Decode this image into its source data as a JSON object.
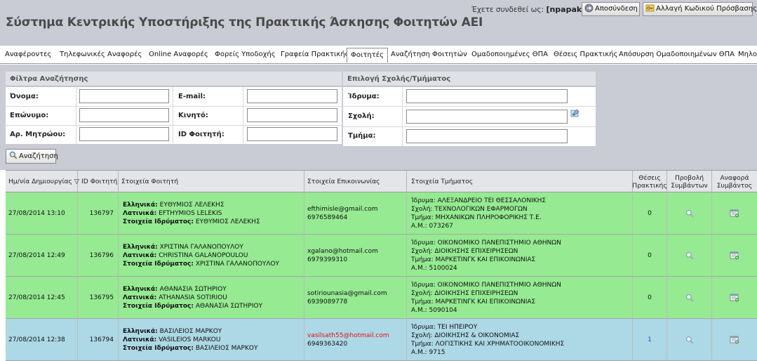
{
  "header": {
    "title": "Σύστημα Κεντρικής Υποστήριξης της Πρακτικής Άσκησης Φοιτητών ΑΕΙ",
    "login_prefix": "Έχετε συνδεθεί ως:",
    "username": "[npapako]",
    "logout_label": "Αποσύνδεση",
    "change_password_label": "Αλλαγή Κωδικού Πρόσβασης"
  },
  "nav": {
    "items": [
      "Αναφέροντες",
      "Τηλεφωνικές Αναφορές",
      "Online Αναφορές",
      "Φορείς Υποδοχής",
      "Γραφεία Πρακτικής",
      "Φοιτητές",
      "Αναζήτηση Φοιτητών",
      "Ομαδοποιημένες ΘΠΑ",
      "Θέσεις Πρακτικής",
      "Απόσυρση Ομαδοποιημένων ΘΠΑ",
      "Μηλο"
    ],
    "active": "Φοιτητές"
  },
  "filters": {
    "title": "Φίλτρα Αναζήτησης",
    "name_label": "Όνομα:",
    "surname_label": "Επώνυμο:",
    "reg_no_label": "Αρ. Μητρώου:",
    "email_label": "E-mail:",
    "mobile_label": "Κινητό:",
    "student_id_label": "ID Φοιτητή:",
    "name_value": "",
    "surname_value": "",
    "reg_no_value": "",
    "email_value": "",
    "mobile_value": "",
    "student_id_value": ""
  },
  "school_select": {
    "title": "Επιλογή Σχολής/Τμήματος",
    "institution_label": "Ίδρυμα:",
    "school_label": "Σχολή:",
    "department_label": "Τμήμα:",
    "institution_value": "",
    "school_value": "",
    "department_value": ""
  },
  "search_button": "Αναζήτηση",
  "table": {
    "headers": {
      "created": "Ημ/νία Δημιουργίας ▽",
      "student_id": "ID Φοιτητή",
      "student_info": "Στοιχεία Φοιτητή",
      "contact_info": "Στοιχεία Επικοινωνίας",
      "dept_info": "Στοιχεία Τμήματος",
      "positions": "Θέσεις Πρακτικής",
      "view_contracts": "Προβολή Συμβάντων",
      "report_contract": "Αναφορά Συμβάντος"
    },
    "labels": {
      "greek": "Ελληνικά:",
      "latin": "Λατινικά:",
      "institution_data": "Στοιχεία Ιδρύματος:"
    },
    "rows": [
      {
        "date": "27/08/2014 13:10",
        "id": "136797",
        "greek": "ΕΥΘΥΜΙΟΣ ΛΕΛΕΚΗΣ",
        "latin": "EFTHYMIOS LELEKIS",
        "inst": "ΕΥΘΥΜΙΟΣ ΛΕΛΕΚΗΣ",
        "email": "efthimisle@gmail.com",
        "phone": "6976589464",
        "institution": "Ίδρυμα: ΑΛΕΞΑΝΔΡΕΙΟ ΤΕΙ ΘΕΣΣΑΛΟΝΙΚΗΣ",
        "school": "Σχολή: ΤΕΧΝΟΛΟΓΙΚΩΝ ΕΦΑΡΜΟΓΩΝ",
        "department": "Τμήμα: ΜΗΧΑΝΙΚΩΝ ΠΛΗΡΟΦΟΡΙΚΗΣ Τ.Ε.",
        "am": "Α.Μ.: 073267",
        "positions": "0",
        "color": "#95ea92",
        "email_red": false
      },
      {
        "date": "27/08/2014 12:49",
        "id": "136796",
        "greek": "ΧΡΙΣΤΙΝΑ ΓΑΛΑΝΟΠΟΥΛΟΥ",
        "latin": "CHRISTINA GALANOPOULOU",
        "inst": "ΧΡΙΣΤΙΝΑ ΓΑΛΑΝΟΠΟΥΛΟΥ",
        "email": "xgalano@hotmail.com",
        "phone": "6979399310",
        "institution": "Ίδρυμα: ΟΙΚΟΝΟΜΙΚΟ ΠΑΝΕΠΙΣΤΗΜΙΟ ΑΘΗΝΩΝ",
        "school": "Σχολή: ΔΙΟΙΚΗΣΗΣ ΕΠΙΧΕΙΡΗΣΕΩΝ",
        "department": "Τμήμα: ΜΑΡΚΕΤΙΝΓΚ ΚΑΙ ΕΠΙΚΟΙΝΩΝΙΑΣ",
        "am": "Α.Μ.: 5100024",
        "positions": "0",
        "color": "#95ea92",
        "email_red": false
      },
      {
        "date": "27/08/2014 12:45",
        "id": "136795",
        "greek": "ΑΘΑΝΑΣΙΑ ΣΩΤΗΡΙΟΥ",
        "latin": "ATHANASIA SOTIRIOU",
        "inst": "ΑΘΑΝΑΣΙΑ ΣΩΤΗΡΙΟΥ",
        "email": "sotiriounasia@gmail.com",
        "phone": "6939089778",
        "institution": "Ίδρυμα: ΟΙΚΟΝΟΜΙΚΟ ΠΑΝΕΠΙΣΤΗΜΙΟ ΑΘΗΝΩΝ",
        "school": "Σχολή: ΔΙΟΙΚΗΣΗΣ ΕΠΙΧΕΙΡΗΣΕΩΝ",
        "department": "Τμήμα: ΜΑΡΚΕΤΙΝΓΚ ΚΑΙ ΕΠΙΚΟΙΝΩΝΙΑΣ",
        "am": "Α.Μ.: 5090104",
        "positions": "0",
        "color": "#95ea92",
        "email_red": false
      },
      {
        "date": "27/08/2014 12:38",
        "id": "136794",
        "greek": "ΒΑΣΙΛΕΙΟΣ ΜΑΡΚΟΥ",
        "latin": "VASILEIOS MARKOU",
        "inst": "ΒΑΣΙΛΕΙΟΣ ΜΑΡΚΟΥ",
        "email": "vasilsath55@hotmail.com",
        "phone": "6949363420",
        "institution": "Ίδρυμα: ΤΕΙ ΗΠΕΙΡΟΥ",
        "school": "Σχολή: ΔΙΟΙΚΗΣΗΣ & ΟΙΚΟΝΟΜΙΑΣ",
        "department": "Τμήμα: ΛΟΓΙΣΤΙΚΗΣ ΚΑΙ ΧΡΗΜΑΤΟΟΙΚΟΝΟΜΙΚΗΣ",
        "am": "Α.Μ.: 9715",
        "positions": "1",
        "color": "#add8e6",
        "email_red": true
      }
    ]
  },
  "icons": {
    "logout": "logout-icon",
    "password": "key-icon",
    "search": "magnifier-icon",
    "school_picker": "edit-check-icon",
    "view_contracts": "magnifier-icon",
    "report_contract": "report-add-icon"
  }
}
